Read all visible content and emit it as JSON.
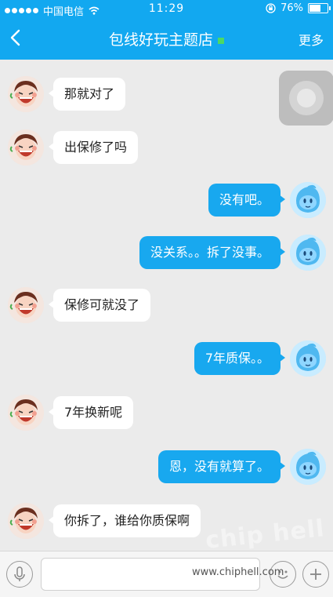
{
  "status_bar": {
    "carrier": "中国电信",
    "time": "11:29",
    "battery": "76%",
    "battery_level": 0.76
  },
  "header": {
    "title": "包线好玩主题店",
    "more": "更多"
  },
  "messages": [
    {
      "side": "other",
      "text": "那就对了"
    },
    {
      "side": "other",
      "text": "出保修了吗"
    },
    {
      "side": "me",
      "text": "没有吧。"
    },
    {
      "side": "me",
      "text": "没关系。。拆了没事。"
    },
    {
      "side": "other",
      "text": "保修可就没了"
    },
    {
      "side": "me",
      "text": "7年质保。。"
    },
    {
      "side": "other",
      "text": "7年换新呢"
    },
    {
      "side": "me",
      "text": "恩，没有就算了。"
    },
    {
      "side": "other",
      "text": "你拆了，谁给你质保啊"
    }
  ],
  "watermark": "www.chiphell.com",
  "logo": "chip hell",
  "icons": {
    "back": "back-arrow-icon",
    "signal": "signal-dots-icon",
    "wifi": "wifi-icon",
    "lock": "rotation-lock-icon",
    "battery": "battery-icon",
    "mic": "microphone-icon",
    "emoji": "emoji-icon",
    "plus": "plus-icon"
  }
}
